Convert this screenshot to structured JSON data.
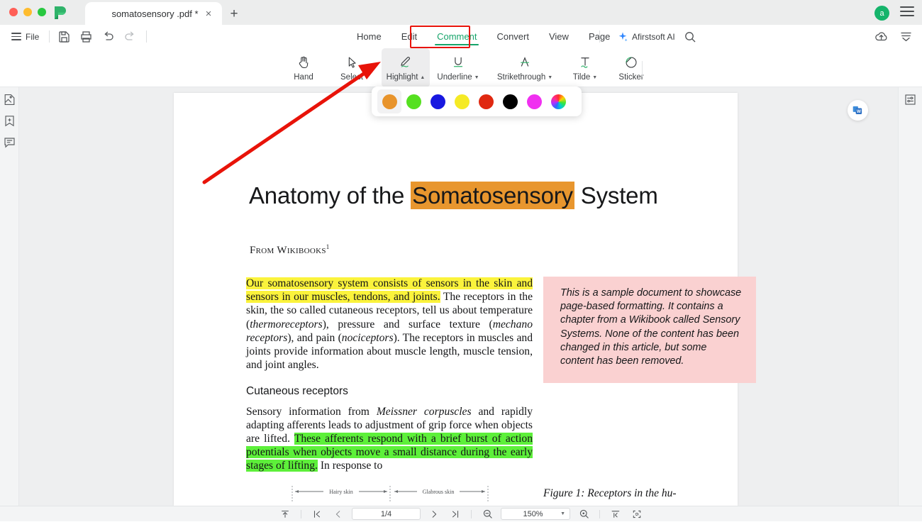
{
  "window": {
    "app_logo": "pdf-app-logo",
    "tab": {
      "title": "somatosensory .pdf *",
      "close": "×"
    },
    "new_tab": "+",
    "avatar_initial": "a"
  },
  "menubar": {
    "file_label": "File",
    "quick_tools": [
      "save-icon",
      "print-icon",
      "undo-icon",
      "redo-icon"
    ],
    "items": [
      {
        "label": "Home",
        "active": false
      },
      {
        "label": "Edit",
        "active": false
      },
      {
        "label": "Comment",
        "active": true
      },
      {
        "label": "Convert",
        "active": false
      },
      {
        "label": "View",
        "active": false
      },
      {
        "label": "Page",
        "active": false
      }
    ],
    "ai_label": "Afirstsoft AI",
    "accent_color": "#16a46a",
    "annotation_box_color": "#e81309"
  },
  "ribbon": {
    "tools": [
      {
        "label": "Hand",
        "icon": "hand-icon",
        "caret": false,
        "selected": false
      },
      {
        "label": "Select",
        "icon": "cursor-arrow-icon",
        "caret": false,
        "selected": false
      },
      {
        "label": "Highlight",
        "icon": "highlight-pen-icon",
        "caret": true,
        "caret_glyph": "▲",
        "selected": true
      },
      {
        "label": "Underline",
        "icon": "underline-icon",
        "caret": true,
        "caret_glyph": "▼",
        "selected": false
      },
      {
        "label": "Strikethrough",
        "icon": "strikethrough-icon",
        "caret": true,
        "caret_glyph": "▼",
        "selected": false
      },
      {
        "label": "Tilde",
        "icon": "tilde-icon",
        "caret": true,
        "caret_glyph": "▼",
        "selected": false
      },
      {
        "label": "Sticker",
        "icon": "sticker-icon",
        "caret": false,
        "selected": false
      }
    ]
  },
  "color_palette": {
    "swatches": [
      {
        "name": "orange",
        "hex": "#e8942c",
        "selected": true
      },
      {
        "name": "green",
        "hex": "#55e020",
        "selected": false
      },
      {
        "name": "blue",
        "hex": "#1818e0",
        "selected": false
      },
      {
        "name": "yellow",
        "hex": "#f5ea25",
        "selected": false
      },
      {
        "name": "red",
        "hex": "#e02810",
        "selected": false
      },
      {
        "name": "black",
        "hex": "#000000",
        "selected": false
      },
      {
        "name": "magenta",
        "hex": "#f030f0",
        "selected": false
      },
      {
        "name": "custom-color-wheel",
        "hex": "rainbow",
        "selected": false
      }
    ]
  },
  "left_rail": {
    "items": [
      {
        "name": "thumbnails-icon"
      },
      {
        "name": "bookmark-add-icon"
      },
      {
        "name": "comments-panel-icon"
      }
    ]
  },
  "document": {
    "title_pre": "Anatomy of the ",
    "title_highlight": "Somatosensory",
    "title_post": " System",
    "from_line": "From Wikibooks",
    "from_sup": "1",
    "para1_highlight": "Our somatosensory system consists of sensors in the skin and sensors in our muscles, tendons, and joints.",
    "para1_rest_a": " The receptors in the skin, the so called cutaneous receptors, tell us about temperature (",
    "para1_it1": "thermoreceptors",
    "para1_rest_b": "), pressure and surface texture (",
    "para1_it2": "mechano receptors",
    "para1_rest_c": "), and pain (",
    "para1_it3": "nociceptors",
    "para1_rest_d": "). The receptors in muscles and joints provide information about muscle length, muscle tension, and joint angles.",
    "section_heading": "Cutaneous receptors",
    "para2_a": "Sensory information from ",
    "para2_it1": "Meissner corpuscles",
    "para2_b": " and rapidly adapting afferents leads to adjustment of grip force when objects are lifted. ",
    "para2_highlight": "These afferents respond with a brief burst of action potentials when objects move a small distance during the early stages of lifting.",
    "para2_c": " In response to",
    "note_text": "This is a sample document to showcase page-based formatting. It contains a chapter from a Wikibook called Sensory Systems. None of the content has been changed in this article, but some content has been removed.",
    "figure_caption": "Figure 1:   Receptors in the hu-",
    "figure_label_left": "Hairy skin",
    "figure_label_right": "Glabrous skin",
    "highlight_colors": {
      "title": "#e8962e",
      "para1": "#fbf33c",
      "para2": "#5df03a",
      "note_bg": "#fad1d1"
    },
    "word_badge": "convert-to-word-icon"
  },
  "statusbar": {
    "page_value": "1/4",
    "zoom_value": "150%",
    "zoom_caret": "▼",
    "icons": [
      "scroll-to-top-icon",
      "first-page-icon",
      "previous-page-icon",
      "next-page-icon",
      "last-page-icon",
      "zoom-out-icon",
      "zoom-in-icon",
      "fit-width-icon",
      "fit-page-icon"
    ]
  }
}
